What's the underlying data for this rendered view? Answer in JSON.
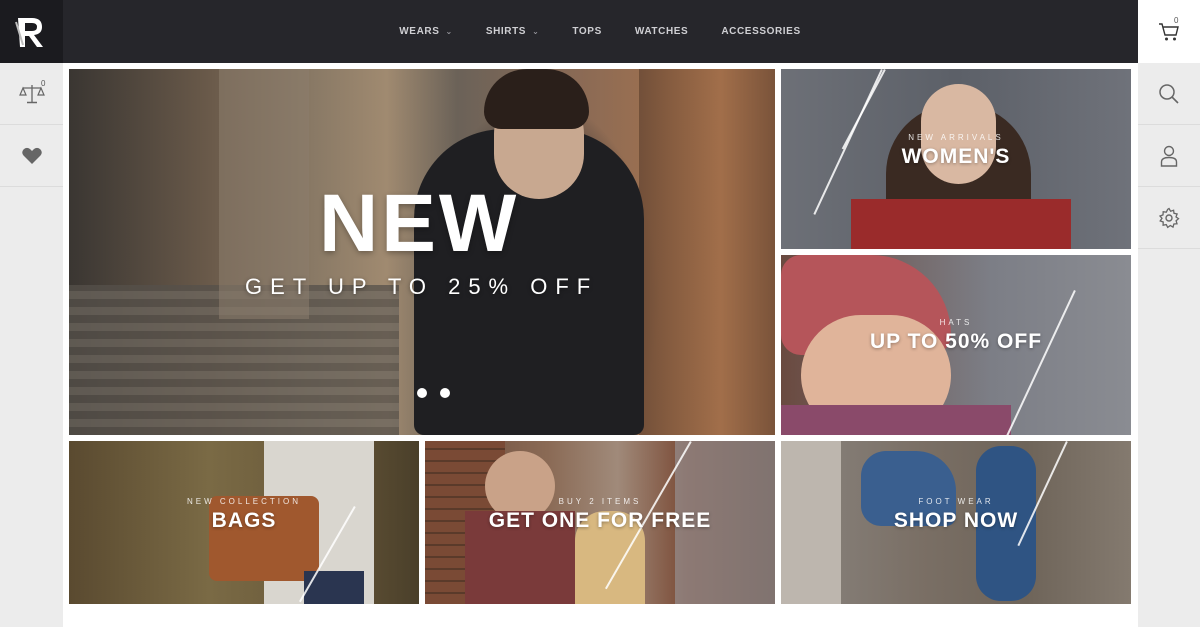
{
  "brand": {
    "logo_letter": "R"
  },
  "nav": {
    "items": [
      {
        "label": "WEARS",
        "has_dropdown": true
      },
      {
        "label": "SHIRTS",
        "has_dropdown": true
      },
      {
        "label": "TOPS",
        "has_dropdown": false
      },
      {
        "label": "WATCHES",
        "has_dropdown": false
      },
      {
        "label": "ACCESSORIES",
        "has_dropdown": false
      }
    ]
  },
  "cart": {
    "count": "0",
    "icon": "cart-icon"
  },
  "left_sidebar": {
    "compare": {
      "icon": "scale-icon",
      "count": "0"
    },
    "wishlist": {
      "icon": "heart-icon"
    }
  },
  "right_sidebar": {
    "search": {
      "icon": "search-icon"
    },
    "account": {
      "icon": "user-icon"
    },
    "settings": {
      "icon": "gear-icon"
    }
  },
  "hero": {
    "title": "NEW",
    "subtitle": "GET UP TO 25% OFF",
    "slides": 2,
    "active_slide": 1
  },
  "promos": {
    "womens": {
      "small": "NEW ARRIVALS",
      "big": "WOMEN'S"
    },
    "hats": {
      "small": "HATS",
      "big": "UP TO 50% OFF"
    },
    "bags": {
      "small": "NEW COLLECTION",
      "big": "BAGS"
    },
    "buy2": {
      "small": "BUY 2 ITEMS",
      "big": "GET ONE FOR FREE"
    },
    "footwear": {
      "small": "FOOT WEAR",
      "big": "SHOP NOW"
    }
  },
  "colors": {
    "topbar": "#26262b",
    "sidebar": "#ececec",
    "accent": "#ffffff"
  }
}
